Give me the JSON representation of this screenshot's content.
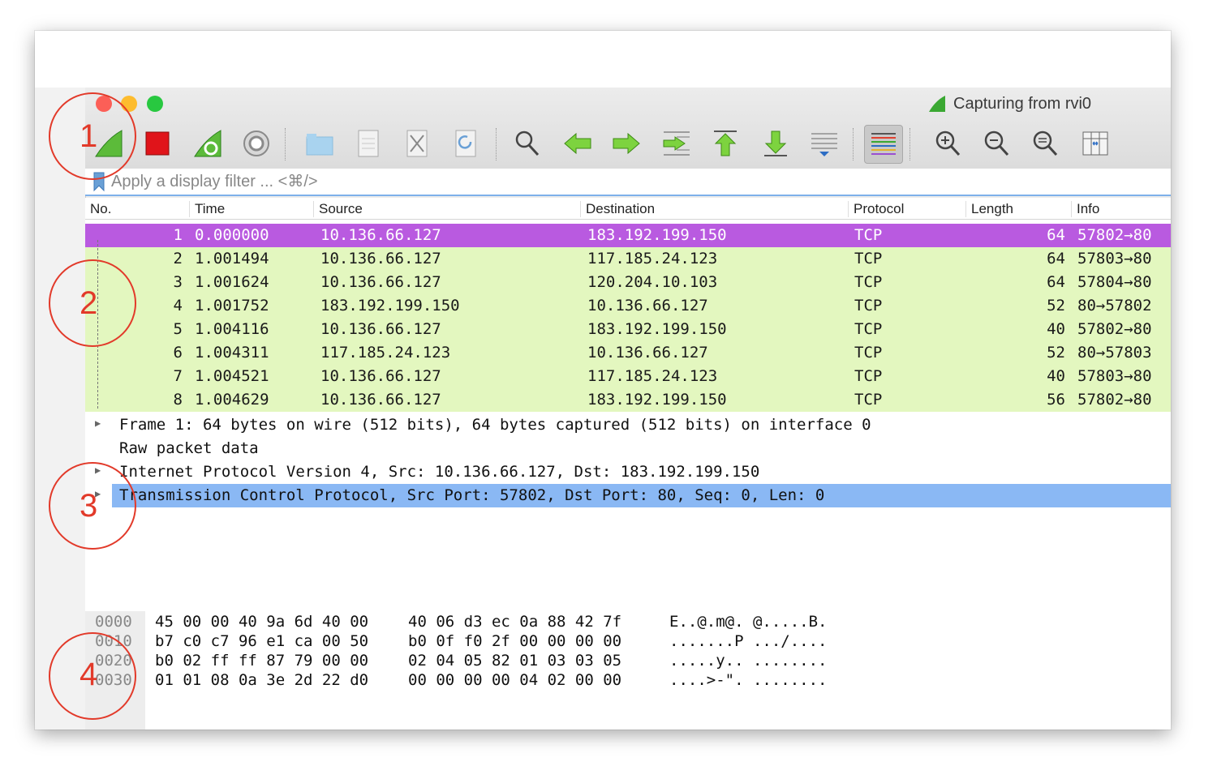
{
  "window": {
    "capture_status": "Capturing from rvi0",
    "traffic_colors": {
      "close": "#fc5f57",
      "minimize": "#fdbc2e",
      "zoom": "#28c840"
    }
  },
  "toolbar": {
    "buttons": [
      "start-capture",
      "stop-capture",
      "restart-capture",
      "capture-options",
      "open-file",
      "save-file",
      "close-file",
      "reload-file",
      "find-packet",
      "go-back",
      "go-forward",
      "go-to-packet",
      "first-packet",
      "last-packet",
      "auto-scroll",
      "colorize",
      "zoom-in",
      "zoom-out",
      "normal-size",
      "resize-columns"
    ]
  },
  "filter": {
    "placeholder": "Apply a display filter ... <⌘/>"
  },
  "packet_list": {
    "columns": [
      "No.",
      "Time",
      "Source",
      "Destination",
      "Protocol",
      "Length",
      "Info"
    ],
    "rows": [
      {
        "no": "1",
        "time": "0.000000",
        "source": "10.136.66.127",
        "destination": "183.192.199.150",
        "protocol": "TCP",
        "length": "64",
        "info": "57802→80"
      },
      {
        "no": "2",
        "time": "1.001494",
        "source": "10.136.66.127",
        "destination": "117.185.24.123",
        "protocol": "TCP",
        "length": "64",
        "info": "57803→80"
      },
      {
        "no": "3",
        "time": "1.001624",
        "source": "10.136.66.127",
        "destination": "120.204.10.103",
        "protocol": "TCP",
        "length": "64",
        "info": "57804→80"
      },
      {
        "no": "4",
        "time": "1.001752",
        "source": "183.192.199.150",
        "destination": "10.136.66.127",
        "protocol": "TCP",
        "length": "52",
        "info": "80→57802"
      },
      {
        "no": "5",
        "time": "1.004116",
        "source": "10.136.66.127",
        "destination": "183.192.199.150",
        "protocol": "TCP",
        "length": "40",
        "info": "57802→80"
      },
      {
        "no": "6",
        "time": "1.004311",
        "source": "117.185.24.123",
        "destination": "10.136.66.127",
        "protocol": "TCP",
        "length": "52",
        "info": "80→57803"
      },
      {
        "no": "7",
        "time": "1.004521",
        "source": "10.136.66.127",
        "destination": "117.185.24.123",
        "protocol": "TCP",
        "length": "40",
        "info": "57803→80"
      },
      {
        "no": "8",
        "time": "1.004629",
        "source": "10.136.66.127",
        "destination": "183.192.199.150",
        "protocol": "TCP",
        "length": "56",
        "info": "57802→80"
      }
    ],
    "selected_color": "#b95ae0",
    "row_color": "#e3f7bf"
  },
  "details": {
    "lines": [
      "Frame 1: 64 bytes on wire (512 bits), 64 bytes captured (512 bits) on interface 0",
      "Raw packet data",
      "Internet Protocol Version 4, Src: 10.136.66.127, Dst: 183.192.199.150",
      "Transmission Control Protocol, Src Port: 57802, Dst Port: 80, Seq: 0, Len: 0"
    ]
  },
  "bytes": {
    "lines": [
      {
        "offset": "0000",
        "hex1": "45 00 00 40 9a 6d 40 00",
        "hex2": "40 06 d3 ec 0a 88 42 7f",
        "ascii": "E..@.m@. @.....B."
      },
      {
        "offset": "0010",
        "hex1": "b7 c0 c7 96 e1 ca 00 50",
        "hex2": "b0 0f f0 2f 00 00 00 00",
        "ascii": ".......P .../...."
      },
      {
        "offset": "0020",
        "hex1": "b0 02 ff ff 87 79 00 00",
        "hex2": "02 04 05 82 01 03 03 05",
        "ascii": ".....y.. ........"
      },
      {
        "offset": "0030",
        "hex1": "01 01 08 0a 3e 2d 22 d0",
        "hex2": "00 00 00 00 04 02 00 00",
        "ascii": "....>-\". ........"
      }
    ]
  },
  "callouts": [
    "1",
    "2",
    "3",
    "4"
  ]
}
